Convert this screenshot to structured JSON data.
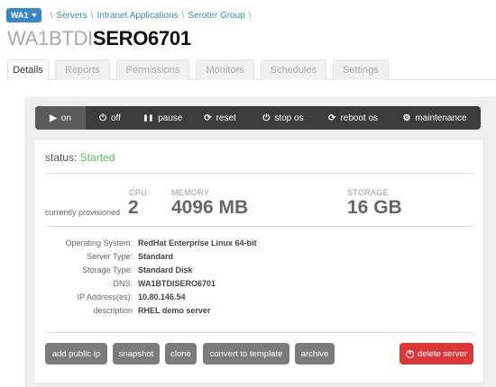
{
  "breadcrumb": {
    "datacenter": "WA1",
    "items": [
      "Servers",
      "Intranet Applications",
      "Seroter Group"
    ],
    "separator": "\\"
  },
  "title": {
    "prefix": "WA1BTDI",
    "name": "SERO6701"
  },
  "tabs": [
    {
      "label": "Details",
      "active": true
    },
    {
      "label": "Reports"
    },
    {
      "label": "Permissions"
    },
    {
      "label": "Monitors"
    },
    {
      "label": "Schedules"
    },
    {
      "label": "Settings"
    }
  ],
  "power": [
    {
      "label": "on",
      "icon": "play-icon",
      "glyph": "▶",
      "active": true
    },
    {
      "label": "off",
      "icon": "power-icon",
      "glyph": "⏻"
    },
    {
      "label": "pause",
      "icon": "pause-icon",
      "glyph": "❚❚"
    },
    {
      "label": "reset",
      "icon": "refresh-icon",
      "glyph": "⟳"
    },
    {
      "label": "stop os",
      "icon": "power-icon",
      "glyph": "⏻"
    },
    {
      "label": "reboot os",
      "icon": "refresh-icon",
      "glyph": "⟳"
    },
    {
      "label": "maintenance",
      "icon": "gear-icon",
      "glyph": "⚙"
    }
  ],
  "status": {
    "label": "status:",
    "value": "Started",
    "color": "#5cb85c"
  },
  "provisioned": {
    "label": "currently provisioned",
    "cpu_label": "CPU",
    "cpu": "2",
    "memory_label": "MEMORY",
    "memory": "4096 MB",
    "storage_label": "STORAGE",
    "storage": "16 GB"
  },
  "details": [
    {
      "key": "Operating System:",
      "value": "RedHat Enterprise Linux 64-bit"
    },
    {
      "key": "Server Type:",
      "value": "Standard"
    },
    {
      "key": "Storage Type:",
      "value": "Standard Disk"
    },
    {
      "key": "DNS:",
      "value": "WA1BTDISERO6701"
    },
    {
      "key": "IP Address(es):",
      "value": "10.80.146.54"
    },
    {
      "key": "description",
      "value": "RHEL demo server"
    }
  ],
  "actions": {
    "add_public_ip": "add public ip",
    "snapshot": "snapshot",
    "clone": "clone",
    "convert": "convert to template",
    "archive": "archive",
    "delete": "delete server"
  },
  "colors": {
    "accent": "#3a87c8",
    "danger": "#d9373a",
    "success": "#5cb85c"
  }
}
